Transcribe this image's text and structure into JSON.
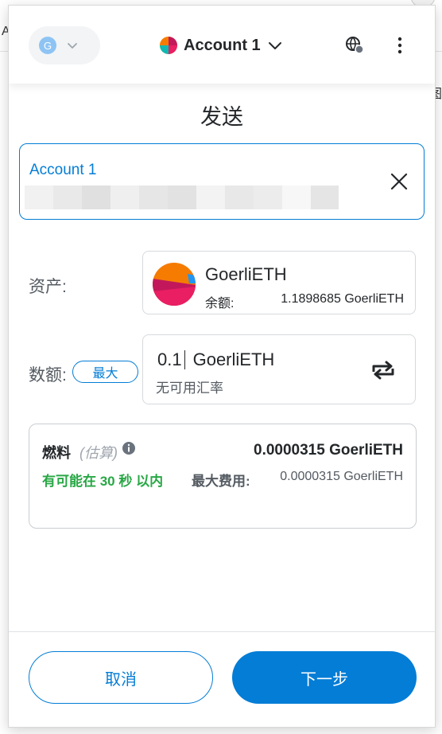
{
  "background": {
    "left_glyph": "A",
    "right_glyph": "图"
  },
  "header": {
    "network_initial": "G",
    "account_name": "Account 1",
    "icons": {
      "network_chevron": "chevron-down-icon",
      "account_chevron": "chevron-down-icon",
      "connected_sites": "globe-status-icon",
      "menu": "kebab-menu-icon"
    }
  },
  "page": {
    "title": "发送"
  },
  "recipient": {
    "name": "Account 1",
    "clear_icon": "close-icon"
  },
  "asset": {
    "label": "资产:",
    "name": "GoerliETH",
    "balance_label": "余额:",
    "balance_value": "1.1898685 GoerliETH"
  },
  "amount": {
    "label": "数额:",
    "max_label": "最大",
    "value": "0.1",
    "unit": "GoerliETH",
    "conversion_note": "无可用汇率",
    "swap_icon": "swap-arrows-icon"
  },
  "gas": {
    "title": "燃料",
    "estimate_tag": "(估算)",
    "total": "0.0000315 GoerliETH",
    "time_estimate": "有可能在 30 秒 以内",
    "max_fee_label": "最大费用:",
    "max_fee_value": "0.0000315 GoerliETH"
  },
  "footer": {
    "cancel_label": "取消",
    "next_label": "下一步"
  },
  "colors": {
    "primary": "#037dd6",
    "success": "#28a745",
    "text": "#24272a",
    "muted": "#535a61"
  }
}
